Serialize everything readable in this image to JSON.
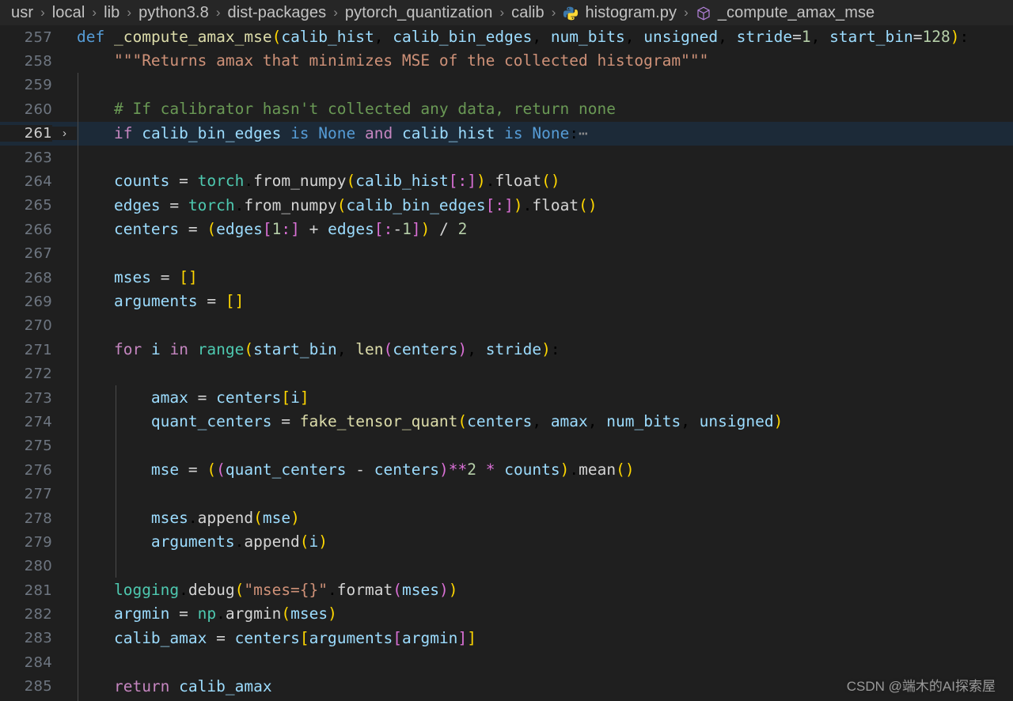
{
  "breadcrumb": {
    "items": [
      {
        "label": "usr",
        "icon": null
      },
      {
        "label": "local",
        "icon": null
      },
      {
        "label": "lib",
        "icon": null
      },
      {
        "label": "python3.8",
        "icon": null
      },
      {
        "label": "dist-packages",
        "icon": null
      },
      {
        "label": "pytorch_quantization",
        "icon": null
      },
      {
        "label": "calib",
        "icon": null
      },
      {
        "label": "histogram.py",
        "icon": "python-file-icon"
      },
      {
        "label": "_compute_amax_mse",
        "icon": "symbol-method-cube-icon"
      }
    ],
    "separator": "›"
  },
  "editor": {
    "language": "python",
    "active_line": 261,
    "fold_indicator": "›",
    "folded_placeholder": "⋯",
    "colors": {
      "background": "#1f1f1f",
      "breadcrumb_background": "#262626",
      "active_line_background": "#1c2a38",
      "line_number": "#6e7681",
      "keyword_control": "#c586c0",
      "keyword_declaration": "#569cd6",
      "function": "#dcdcaa",
      "variable": "#9cdcfe",
      "module": "#4ec9b0",
      "number": "#b5cea8",
      "string": "#ce9178",
      "comment": "#6a9955",
      "bracket_depth_0": "#ffd700",
      "bracket_depth_1": "#da70d6",
      "bracket_depth_2": "#179fff"
    },
    "lines": [
      {
        "num": "257",
        "fold": "",
        "active": false,
        "text": "def _compute_amax_mse(calib_hist, calib_bin_edges, num_bits, unsigned, stride=1, start_bin=128):"
      },
      {
        "num": "258",
        "fold": "",
        "active": false,
        "text": "    \"\"\"Returns amax that minimizes MSE of the collected histogram\"\"\""
      },
      {
        "num": "259",
        "fold": "",
        "active": false,
        "text": ""
      },
      {
        "num": "260",
        "fold": "",
        "active": false,
        "text": "    # If calibrator hasn't collected any data, return none"
      },
      {
        "num": "261",
        "fold": "›",
        "active": true,
        "text": "    if calib_bin_edges is None and calib_hist is None:⋯"
      },
      {
        "num": "263",
        "fold": "",
        "active": false,
        "text": ""
      },
      {
        "num": "264",
        "fold": "",
        "active": false,
        "text": "    counts = torch.from_numpy(calib_hist[:]).float()"
      },
      {
        "num": "265",
        "fold": "",
        "active": false,
        "text": "    edges = torch.from_numpy(calib_bin_edges[:]).float()"
      },
      {
        "num": "266",
        "fold": "",
        "active": false,
        "text": "    centers = (edges[1:] + edges[:-1]) / 2"
      },
      {
        "num": "267",
        "fold": "",
        "active": false,
        "text": ""
      },
      {
        "num": "268",
        "fold": "",
        "active": false,
        "text": "    mses = []"
      },
      {
        "num": "269",
        "fold": "",
        "active": false,
        "text": "    arguments = []"
      },
      {
        "num": "270",
        "fold": "",
        "active": false,
        "text": ""
      },
      {
        "num": "271",
        "fold": "",
        "active": false,
        "text": "    for i in range(start_bin, len(centers), stride):"
      },
      {
        "num": "272",
        "fold": "",
        "active": false,
        "text": ""
      },
      {
        "num": "273",
        "fold": "",
        "active": false,
        "text": "        amax = centers[i]"
      },
      {
        "num": "274",
        "fold": "",
        "active": false,
        "text": "        quant_centers = fake_tensor_quant(centers, amax, num_bits, unsigned)"
      },
      {
        "num": "275",
        "fold": "",
        "active": false,
        "text": ""
      },
      {
        "num": "276",
        "fold": "",
        "active": false,
        "text": "        mse = ((quant_centers - centers)**2 * counts).mean()"
      },
      {
        "num": "277",
        "fold": "",
        "active": false,
        "text": ""
      },
      {
        "num": "278",
        "fold": "",
        "active": false,
        "text": "        mses.append(mse)"
      },
      {
        "num": "279",
        "fold": "",
        "active": false,
        "text": "        arguments.append(i)"
      },
      {
        "num": "280",
        "fold": "",
        "active": false,
        "text": ""
      },
      {
        "num": "281",
        "fold": "",
        "active": false,
        "text": "    logging.debug(\"mses={}\".format(mses))"
      },
      {
        "num": "282",
        "fold": "",
        "active": false,
        "text": "    argmin = np.argmin(mses)"
      },
      {
        "num": "283",
        "fold": "",
        "active": false,
        "text": "    calib_amax = centers[arguments[argmin]]"
      },
      {
        "num": "284",
        "fold": "",
        "active": false,
        "text": ""
      },
      {
        "num": "285",
        "fold": "",
        "active": false,
        "text": "    return calib_amax"
      }
    ]
  },
  "watermark": {
    "text": "CSDN @端木的AI探索屋"
  }
}
